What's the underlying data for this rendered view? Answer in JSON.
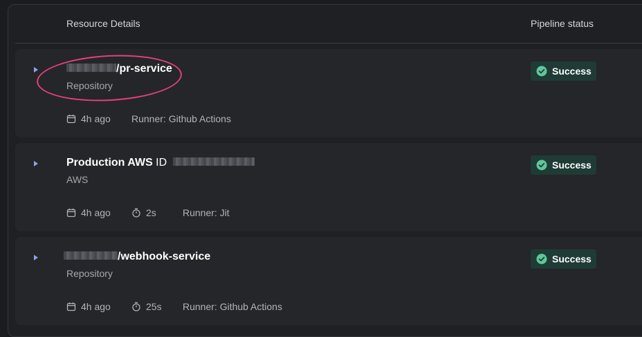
{
  "header": {
    "resource_details": "Resource Details",
    "pipeline_status": "Pipeline status"
  },
  "rows": [
    {
      "title_main": "/pr-service",
      "title_suffix": "",
      "type": "Repository",
      "time_icon": "calendar-icon",
      "time": "4h ago",
      "duration": "",
      "runner": "Runner: Github Actions",
      "status": "Success"
    },
    {
      "title_main": "Production AWS",
      "title_suffix": " ID",
      "type": "AWS",
      "time_icon": "calendar-icon",
      "time": "4h ago",
      "duration": "2s",
      "runner": "Runner: Jit",
      "status": "Success"
    },
    {
      "title_main": "/webhook-service",
      "title_suffix": "",
      "type": "Repository",
      "time_icon": "calendar-icon",
      "time": "4h ago",
      "duration": "25s",
      "runner": "Runner: Github Actions",
      "status": "Success"
    }
  ],
  "colors": {
    "success_bg": "#1f3b35",
    "success_icon": "#5fc79b",
    "highlight": "#e5407a",
    "caret": "#8fa0f5"
  }
}
